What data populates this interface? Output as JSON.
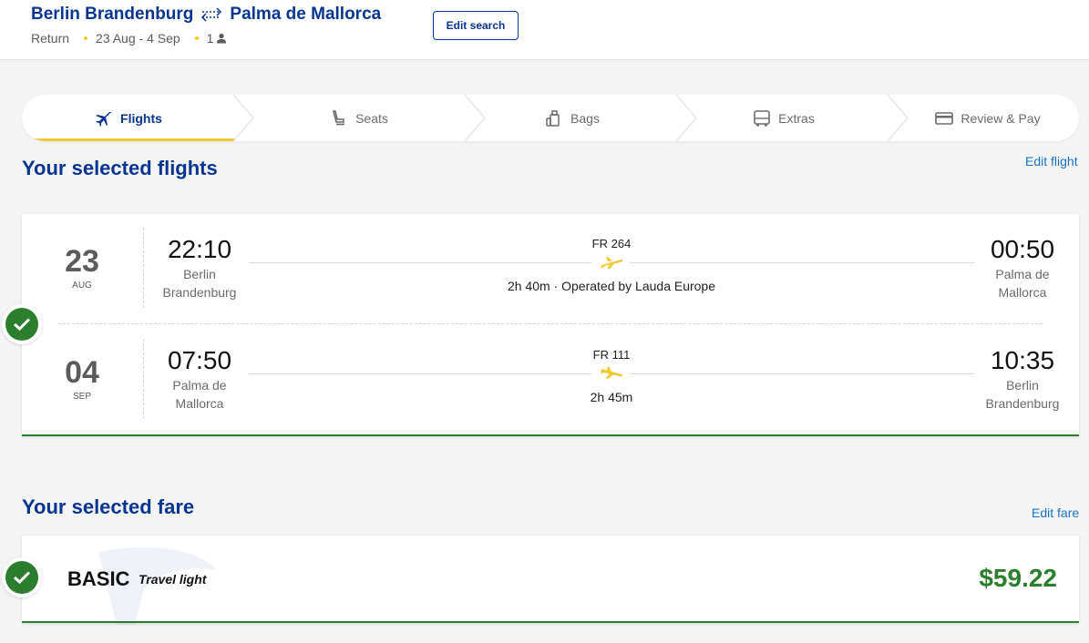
{
  "header": {
    "origin": "Berlin Brandenburg",
    "destination": "Palma de Mallorca",
    "trip_type": "Return",
    "dates": "23 Aug - 4 Sep",
    "passengers": "1",
    "edit_search_label": "Edit search",
    "swap_icon": "round-trip-arrows-icon",
    "passenger_icon": "person-icon"
  },
  "stepper": {
    "steps": [
      {
        "label": "Flights",
        "icon": "plane-icon",
        "active": true
      },
      {
        "label": "Seats",
        "icon": "seat-icon",
        "active": false
      },
      {
        "label": "Bags",
        "icon": "bag-icon",
        "active": false
      },
      {
        "label": "Extras",
        "icon": "bus-icon",
        "active": false
      },
      {
        "label": "Review & Pay",
        "icon": "card-icon",
        "active": false
      }
    ]
  },
  "flights_section": {
    "title": "Your selected flights",
    "edit_label": "Edit flight",
    "flights": [
      {
        "day": "23",
        "month": "AUG",
        "dep_time": "22:10",
        "dep_place": "Berlin Brandenburg",
        "flight_number": "FR 264",
        "info": "2h 40m · Operated by Lauda Europe",
        "arr_time": "00:50",
        "arr_place": "Palma de Mallorca"
      },
      {
        "day": "04",
        "month": "SEP",
        "dep_time": "07:50",
        "dep_place": "Palma de Mallorca",
        "flight_number": "FR 111",
        "info": "2h 45m",
        "arr_time": "10:35",
        "arr_place": "Berlin Brandenburg"
      }
    ]
  },
  "fare_section": {
    "title": "Your selected fare",
    "edit_label": "Edit fare",
    "fare_name": "BASIC",
    "fare_tag": "Travel light",
    "price": "$59.22"
  },
  "colors": {
    "brand_blue": "#073590",
    "accent_yellow": "#f1c933",
    "success_green": "#2d7d2f",
    "link_blue": "#1a73c9"
  }
}
